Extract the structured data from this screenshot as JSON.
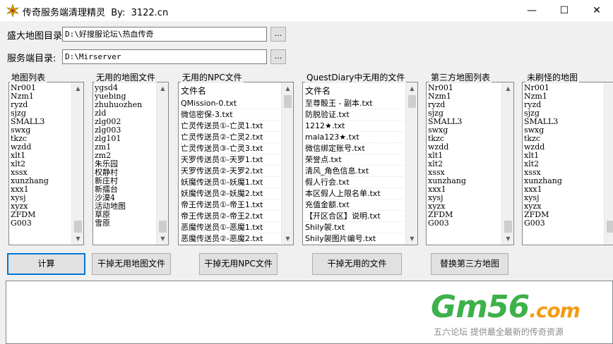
{
  "window": {
    "title": "传奇服务端清理精灵  By:  3122.cn",
    "minimize_glyph": "—",
    "maximize_glyph": "☐",
    "close_glyph": "✕",
    "app_icon": "gear-icon"
  },
  "paths": {
    "map_dir_label": "盛大地图目录:",
    "map_dir_value": "D:\\好搜服论坛\\热血传奇",
    "server_dir_label": "服务端目录:",
    "server_dir_value": "D:\\Mirserver",
    "browse_label": "..."
  },
  "groups": {
    "map_list": {
      "title": "地图列表",
      "items": [
        "Nr001",
        "Nzm1",
        "ryzd",
        "sjzg",
        "SMALL3",
        "swxg",
        "tkzc",
        "wzdd",
        "xlt1",
        "xlt2",
        "xssx",
        "xunzhang",
        "xxx1",
        "xysj",
        "xyzx",
        "ZFDM",
        "G003"
      ]
    },
    "unused_maps": {
      "title": "无用的地图文件",
      "items": [
        "ygsd4",
        "yuebing",
        "zhuhuozhen",
        "zld",
        "zlg002",
        "zlg003",
        "zlg101",
        "zm1",
        "zm2",
        "朱乐园",
        "权静村",
        "新庄村",
        "新擂台",
        "沙漠4",
        "活动地图",
        "草原",
        "雪原"
      ]
    },
    "unused_npc": {
      "title": "无用的NPC文件",
      "header": "文件名",
      "items": [
        "QMission-0.txt",
        "微信密保-3.txt",
        "亡灵传送员①-亡灵1.txt",
        "亡灵传送员②-亡灵2.txt",
        "亡灵传送员③-亡灵3.txt",
        "天罗传送员①-天罗1.txt",
        "天罗传送员②-天罗2.txt",
        "妖魔传送员①-妖魔1.txt",
        "妖魔传送员②-妖魔2.txt",
        "帝王传送员①-帝王1.txt",
        "帝王传送员②-帝王2.txt",
        "恶魔传送员①-恶魔1.txt",
        "恶魔传送员②-恶魔2.txt"
      ]
    },
    "unused_questdiary": {
      "title": "QuestDiary中无用的文件",
      "header": "文件名",
      "items": [
        "至尊骰王 - 副本.txt",
        "防脱验证.txt",
        "1212★.txt",
        "mala123★.txt",
        "微信绑定账号.txt",
        "荣誉点.txt",
        "清风_角色信息.txt",
        "假人行会.txt",
        "本区假人上限名单.txt",
        "充值金额.txt",
        "【开区合区】说明.txt",
        "Shily袈.txt",
        "Shily袈图片编号.txt"
      ]
    },
    "third_party_maps": {
      "title": "第三方地图列表",
      "items": [
        "Nr001",
        "Nzm1",
        "ryzd",
        "sjzg",
        "SMALL3",
        "swxg",
        "tkzc",
        "wzdd",
        "xlt1",
        "xlt2",
        "xssx",
        "xunzhang",
        "xxx1",
        "xysj",
        "xyzx",
        "ZFDM",
        "G003"
      ]
    },
    "unrefreshed_maps": {
      "title": "未刷怪的地图",
      "items": [
        "Nr001",
        "Nzm1",
        "ryzd",
        "sjzg",
        "SMALL3",
        "swxg",
        "tkzc",
        "wzdd",
        "xlt1",
        "xlt2",
        "xssx",
        "xunzhang",
        "xxx1",
        "xysj",
        "xyzx",
        "ZFDM",
        "G003"
      ]
    }
  },
  "buttons": {
    "calculate": "计算",
    "remove_unused_maps": "干掉无用地图文件",
    "remove_unused_npc": "干掉无用NPC文件",
    "remove_unused_files": "干掉无用的文件",
    "replace_third_party_maps": "替换第三方地图"
  },
  "watermark": {
    "logo_main": "Gm56",
    "logo_suffix": ".com",
    "caption": "五六论坛 提供最全最新的传奇资源"
  },
  "colors": {
    "focus_border": "#0078d7",
    "logo_green": "#3db14a",
    "logo_orange": "#f39c12"
  }
}
